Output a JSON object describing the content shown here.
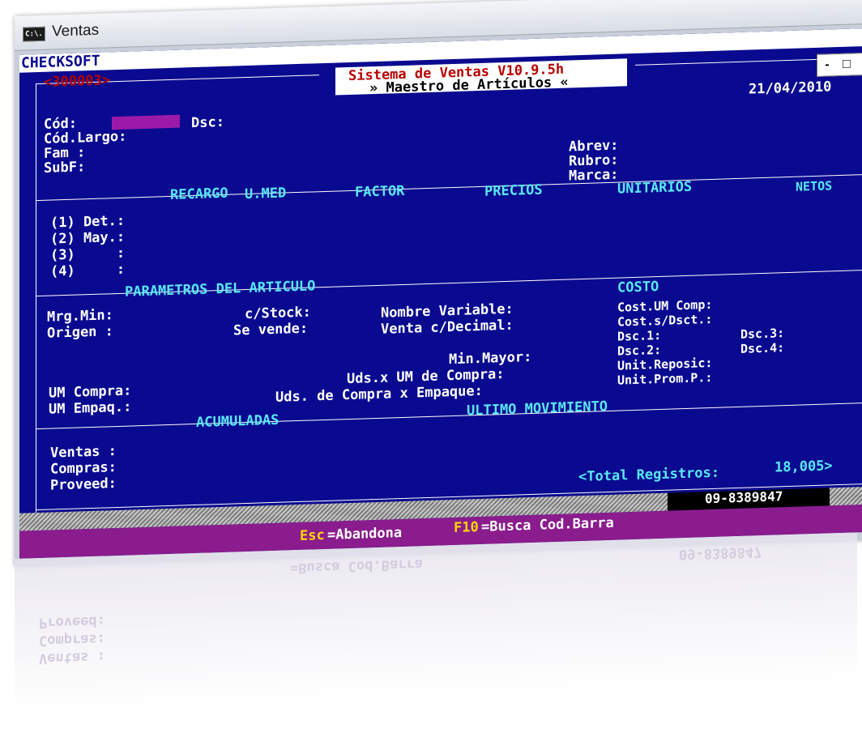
{
  "window": {
    "title": "Ventas",
    "icon_label": "C:\\.",
    "buttons": [
      "-",
      "□",
      "×"
    ]
  },
  "console": {
    "brand": "CHECKSOFT",
    "record_code": "<300003>",
    "app_title": "Sistema de Ventas V10.9.5h",
    "screen_title": "» Maestro de Artículos «",
    "date": "21/04/2010",
    "fields_top": {
      "cod": "Cód:",
      "dsc": "Dsc:",
      "cod_largo": "Cód.Largo:",
      "fam": "Fam :",
      "subf": "SubF:",
      "abrev": "Abrev:",
      "rubro": "Rubro:",
      "marca": "Marca:"
    },
    "price_headers": {
      "recargo": "RECARGO",
      "umed": "U.MED",
      "factor": "FACTOR",
      "precios": "PRECIOS",
      "unitarios": "UNITARIOS",
      "netos": "NETOS"
    },
    "price_rows": [
      "(1) Det.:",
      "(2) May.:",
      "(3)     :",
      "(4)     :"
    ],
    "section_parametros": "PARAMETROS DEL ARTICULO",
    "section_costo": "COSTO",
    "params": {
      "mrg_min": "Mrg.Min:",
      "origen": "Origen :",
      "c_stock": "c/Stock:",
      "se_vende": "Se vende:",
      "nombre_variable": "Nombre Variable:",
      "venta_decimal": "Venta c/Decimal:",
      "min_mayor": "Min.Mayor:",
      "uds_um_compra": "Uds.x UM de Compra:",
      "uds_compra_empaque": "Uds. de Compra x Empaque:",
      "um_compra": "UM Compra:",
      "um_empaq": "UM Empaq.:"
    },
    "costo": {
      "cost_um_comp": "Cost.UM Comp:",
      "cost_s_dsct": "Cost.s/Dsct.:",
      "dsc1": "Dsc.1:",
      "dsc2": "Dsc.2:",
      "dsc3": "Dsc.3:",
      "dsc4": "Dsc.4:",
      "unit_reposic": "Unit.Reposic:",
      "unit_prom_p": "Unit.Prom.P.:"
    },
    "section_acumuladas": "ACUMULADAS",
    "section_ultimo": "ULTIMO MOVIMIENTO",
    "acum": {
      "ventas": "Ventas :",
      "compras": "Compras:",
      "proveed": "Proveed:"
    },
    "total_label": "<Total Registros:",
    "total_value": "18,005>",
    "phone": "09-8389847",
    "status": {
      "esc_key": "Esc",
      "esc_text": "=Abandona",
      "f10_key": "F10",
      "f10_text": "=Busca Cod.Barra"
    }
  },
  "colors": {
    "console_bg": "#0a0a90",
    "section_label": "#58e8f4",
    "app_title": "#b80000",
    "status_bg": "#8a1c8e",
    "status_key": "#ffd700",
    "field_highlight": "#9d1aa8"
  }
}
